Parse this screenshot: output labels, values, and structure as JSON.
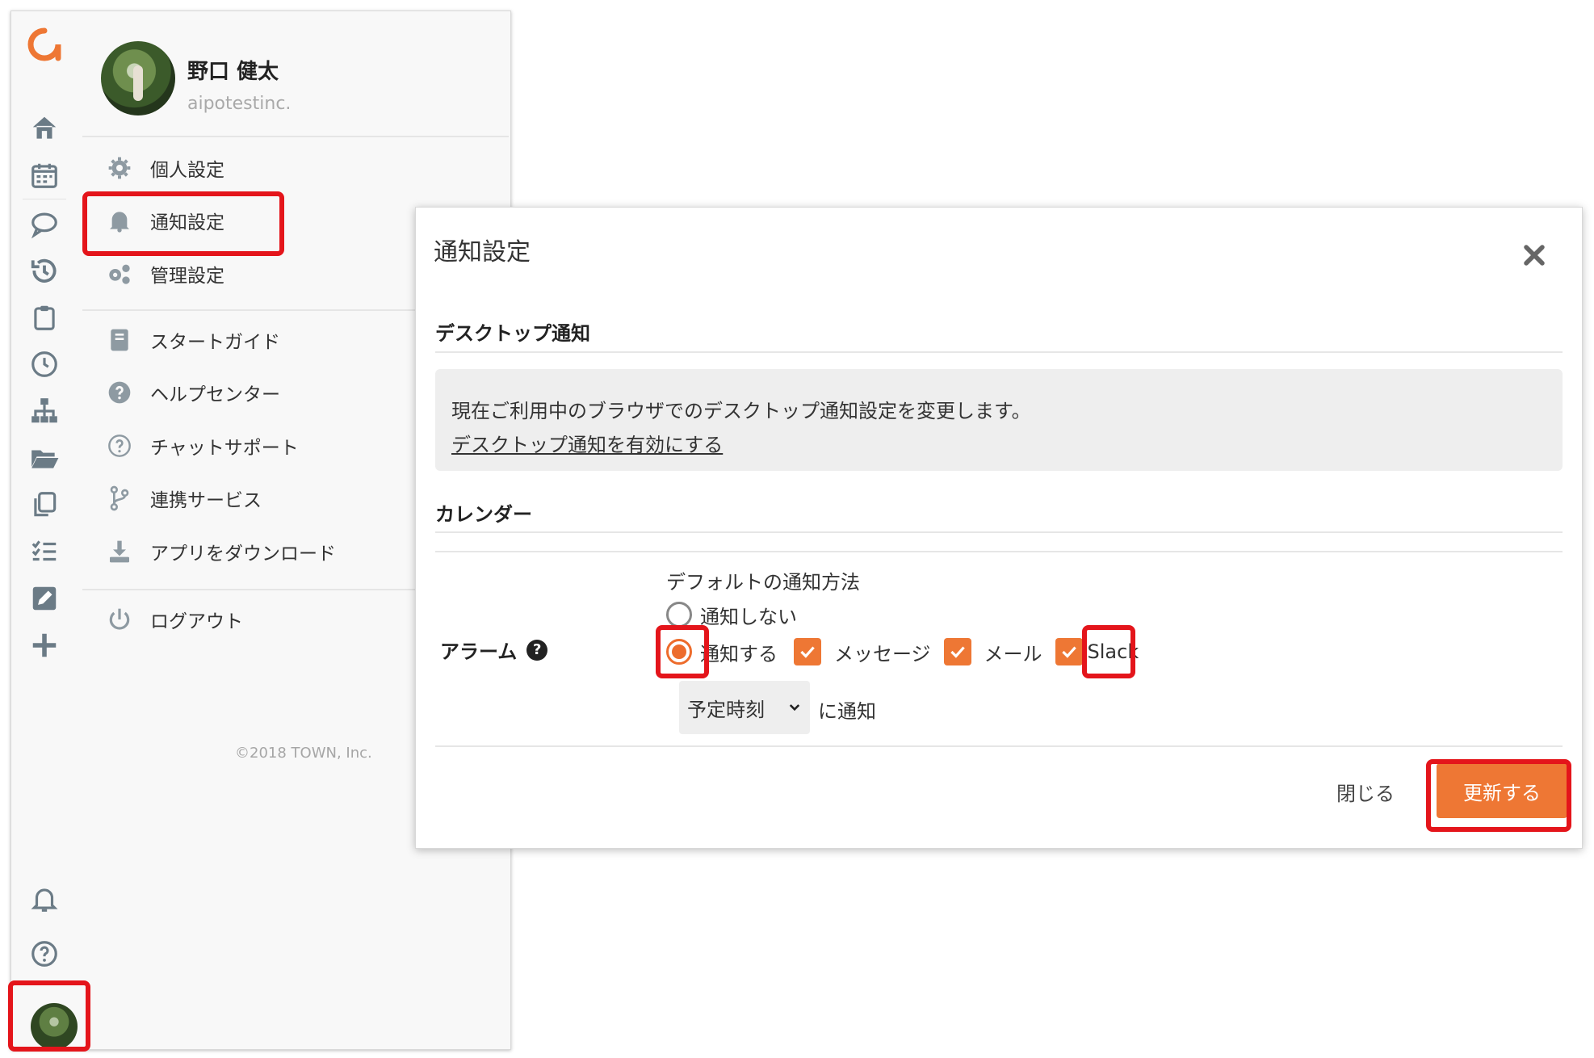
{
  "profile": {
    "name": "野口 健太",
    "org": "aipotestinc."
  },
  "menu": {
    "items": [
      {
        "label": "個人設定",
        "icon": "gear-icon"
      },
      {
        "label": "通知設定",
        "icon": "bell-icon"
      },
      {
        "label": "管理設定",
        "icon": "gears-icon"
      },
      {
        "label": "スタートガイド",
        "icon": "book-icon"
      },
      {
        "label": "ヘルプセンター",
        "icon": "question-circle-icon"
      },
      {
        "label": "チャットサポート",
        "icon": "question-outline-icon"
      },
      {
        "label": "連携サービス",
        "icon": "branch-icon"
      },
      {
        "label": "アプリをダウンロード",
        "icon": "download-icon"
      },
      {
        "label": "ログアウト",
        "icon": "power-icon"
      }
    ],
    "copyright": "©2018 TOWN, Inc."
  },
  "rail": {
    "icons": [
      "home-icon",
      "calendar-icon",
      "chat-icon",
      "history-icon",
      "clipboard-icon",
      "clock-icon",
      "org-chart-icon",
      "folder-icon",
      "copy-icon",
      "checklist-icon",
      "edit-icon",
      "plus-icon",
      "bell-icon",
      "help-icon",
      "avatar"
    ]
  },
  "modal": {
    "title": "通知設定",
    "desktop": {
      "heading": "デスクトップ通知",
      "description": "現在ご利用中のブラウザでのデスクトップ通知設定を変更します。",
      "link": "デスクトップ通知を有効にする"
    },
    "calendar": {
      "heading": "カレンダー",
      "alarm_label": "アラーム",
      "default_method_label": "デフォルトの通知方法",
      "option_off": "通知しない",
      "option_on": "通知する",
      "selected_option": "通知する",
      "channels": [
        {
          "label": "メッセージ",
          "checked": true
        },
        {
          "label": "メール",
          "checked": true
        },
        {
          "label": "Slack",
          "checked": true
        }
      ],
      "timing_value": "予定時刻",
      "timing_suffix": "に通知"
    },
    "footer": {
      "close_label": "閉じる",
      "update_label": "更新する"
    }
  },
  "colors": {
    "accent": "#ee7734",
    "highlight": "#e4151b"
  }
}
